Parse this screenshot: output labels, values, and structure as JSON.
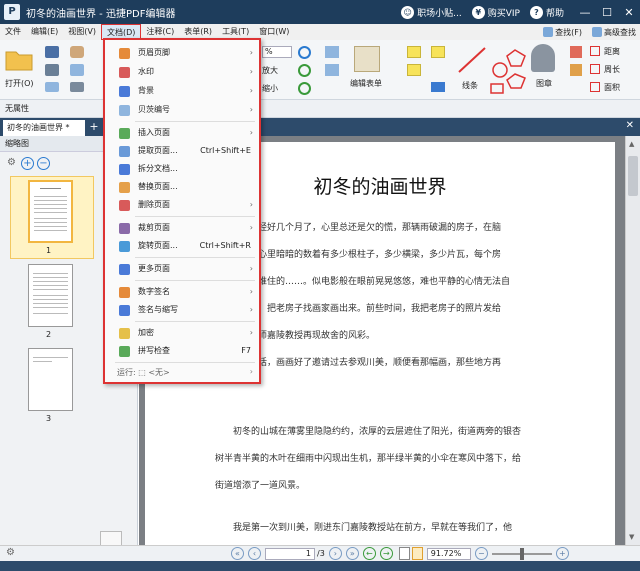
{
  "window": {
    "title": "初冬的油画世界 - 迅捷PDF编辑器",
    "logo_glyph": "P",
    "account": "职场小贴...",
    "vip": "购买VIP",
    "help": "帮助",
    "minimize": "—",
    "maximize": "☐",
    "close": "✕"
  },
  "menubar": {
    "items": [
      "文件",
      "编辑(E)",
      "视图(V)",
      "文档(D)",
      "注释(C)",
      "表单(R)",
      "工具(T)",
      "窗口(W)"
    ],
    "right": [
      "查找(F)",
      "高级查找"
    ]
  },
  "ribbon": {
    "open": "打开(O)",
    "zoom_value": "%",
    "zoom_in": "放大",
    "zoom_out": "缩小",
    "edit_form": "编辑表单",
    "line": "线条",
    "stamp": "图章",
    "distance": "距离",
    "perimeter": "周长",
    "area": "面积"
  },
  "propbar": {
    "label": "无属性"
  },
  "tabs": {
    "active": "初冬的油画世界 *",
    "add": "+",
    "close": "✕"
  },
  "thumbnails": {
    "header": "缩略图",
    "pages": [
      "1",
      "2",
      "3"
    ]
  },
  "document": {
    "title": "初冬的油画世界",
    "lines": [
      "除已经好几个月了，心里总还是欠的慌，那辆雨破漏的房子，在脑",
      "现。心里暗暗的数着有多少根柱子，多少横梁，多少片瓦，每个房",
      "都是谁住的……。似电影般在眼前晃晃悠悠，难也平静的心情无法自",
      "建议，把老房子找画家画出来。前些时间，我把老房子的照片发给",
      "画大师嘉陵教授再现故舍的风彩。",
      "来电话，画画好了邀请过去参观川美，顺便看那幅画，那些地方再",
      "初冬的山城在薄雾里隐隐约约，浓厚的云层遮住了阳光，街道两旁的银杏",
      "树半青半黄的木叶在细雨中闪现出生机，那半绿半黄的小伞在寒风中落下，给",
      "街道增添了一道风景。",
      "我是第一次到川美，刚进东门嘉陵教授站在前方，早就在等我们了，他"
    ]
  },
  "statusbar": {
    "page": "1",
    "total": "/3",
    "zoom": "91.72%"
  },
  "dropdown": {
    "items": [
      {
        "label": "页眉页脚",
        "shortcut": "",
        "submenu": true
      },
      {
        "label": "水印",
        "shortcut": "",
        "submenu": true
      },
      {
        "label": "背景",
        "shortcut": "",
        "submenu": true
      },
      {
        "label": "贝茨编号",
        "shortcut": "",
        "submenu": true
      },
      {
        "label": "插入页面",
        "shortcut": "",
        "submenu": true
      },
      {
        "label": "提取页面...",
        "shortcut": "Ctrl+Shift+E",
        "submenu": false
      },
      {
        "label": "拆分文档...",
        "shortcut": "",
        "submenu": false
      },
      {
        "label": "替换页面...",
        "shortcut": "",
        "submenu": false
      },
      {
        "label": "删除页面",
        "shortcut": "",
        "submenu": true
      },
      {
        "label": "裁剪页面",
        "shortcut": "",
        "submenu": true
      },
      {
        "label": "旋转页面...",
        "shortcut": "Ctrl+Shift+R",
        "submenu": false
      },
      {
        "label": "更多页面",
        "shortcut": "",
        "submenu": true
      },
      {
        "label": "数字签名",
        "shortcut": "",
        "submenu": true
      },
      {
        "label": "签名与缩写",
        "shortcut": "",
        "submenu": true
      },
      {
        "label": "加密",
        "shortcut": "",
        "submenu": true
      },
      {
        "label": "拼写检查",
        "shortcut": "F7",
        "submenu": false
      }
    ],
    "footer": "运行: ⬚ <无>",
    "arrow": "›"
  },
  "colors": {
    "title_bar": "#1e3d5c",
    "menu_highlight": "#dd3333",
    "accent": "#2a7ad0"
  }
}
